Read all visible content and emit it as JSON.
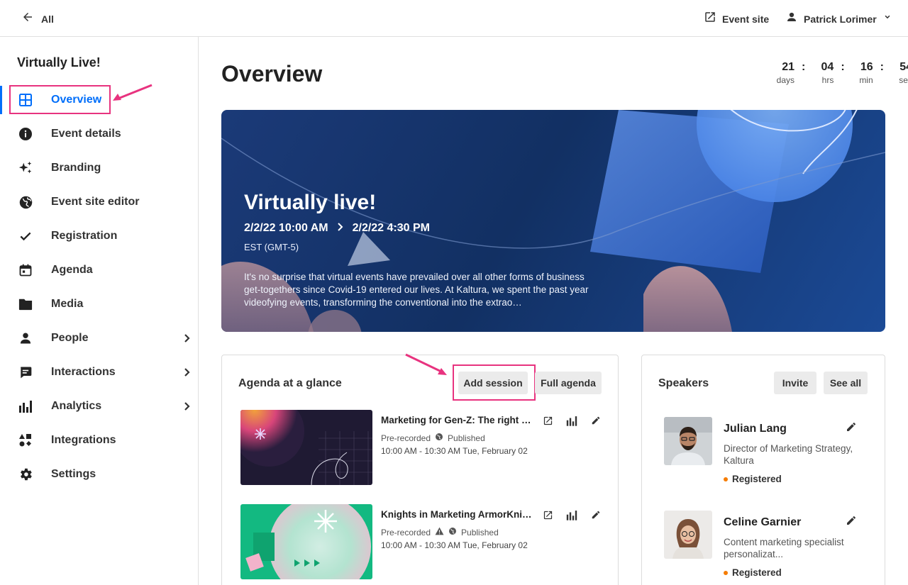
{
  "topbar": {
    "back_label": "All",
    "event_site_label": "Event site",
    "user_name": "Patrick Lorimer"
  },
  "sidebar": {
    "title": "Virtually Live!",
    "items": [
      {
        "label": "Overview",
        "icon": "grid-icon",
        "active": true
      },
      {
        "label": "Event details",
        "icon": "info-icon"
      },
      {
        "label": "Branding",
        "icon": "sparkle-icon"
      },
      {
        "label": "Event site editor",
        "icon": "globe-icon"
      },
      {
        "label": "Registration",
        "icon": "check-icon"
      },
      {
        "label": "Agenda",
        "icon": "calendar-icon"
      },
      {
        "label": "Media",
        "icon": "folder-icon"
      },
      {
        "label": "People",
        "icon": "person-icon",
        "expandable": true
      },
      {
        "label": "Interactions",
        "icon": "chat-icon",
        "expandable": true
      },
      {
        "label": "Analytics",
        "icon": "bar-chart-icon",
        "expandable": true
      },
      {
        "label": "Integrations",
        "icon": "apps-icon"
      },
      {
        "label": "Settings",
        "icon": "gear-icon"
      }
    ]
  },
  "main": {
    "title": "Overview",
    "countdown": {
      "days": "21",
      "days_label": "days",
      "hrs": "04",
      "hrs_label": "hrs",
      "min": "16",
      "min_label": "min",
      "sec": "54",
      "sec_label": "sec"
    },
    "hero": {
      "title": "Virtually live!",
      "start": "2/2/22 10:00 AM",
      "end": "2/2/22 4:30 PM",
      "timezone": "EST (GMT-5)",
      "description": "It's no surprise that virtual events have prevailed over all other forms of business get-togethers since Covid-19 entered our lives. At Kaltura, we spent the past year videofying events, transforming the conventional into the extrao…"
    },
    "agenda": {
      "title": "Agenda at a glance",
      "add_session_label": "Add session",
      "full_agenda_label": "Full agenda",
      "sessions": [
        {
          "title": "Marketing for Gen-Z: The right way",
          "type": "Pre-recorded",
          "status": "Published",
          "time": "10:00 AM - 10:30 AM Tue, February 02"
        },
        {
          "title": "Knights in Marketing ArmorKnights in Marketing Armor",
          "type": "Pre-recorded",
          "status": "Published",
          "time": "10:00 AM - 10:30 AM Tue, February 02"
        }
      ]
    },
    "speakers": {
      "title": "Speakers",
      "invite_label": "Invite",
      "see_all_label": "See all",
      "list": [
        {
          "name": "Julian Lang",
          "role": "Director of Marketing Strategy, Kaltura",
          "status": "Registered"
        },
        {
          "name": "Celine Garnier",
          "role": "Content marketing specialist personalizat...",
          "status": "Registered"
        }
      ]
    }
  },
  "colors": {
    "accent": "#006efa",
    "highlight": "#e8337f",
    "status_dot": "#f57c00"
  }
}
